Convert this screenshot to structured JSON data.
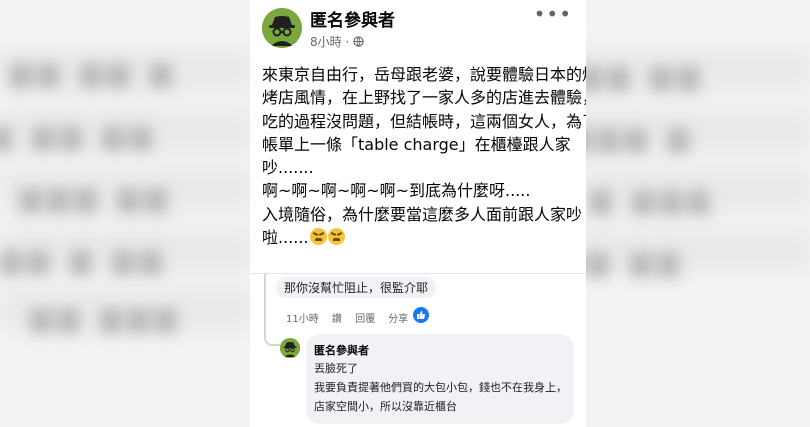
{
  "post": {
    "author": "匿名參與者",
    "time": "8小時",
    "more_label": "•••",
    "lines": [
      "來東京自由行，岳母跟老婆，說要體驗日本的燒",
      "烤店風情，在上野找了一家人多的店進去體驗，",
      "吃的過程沒問題，但結帳時，這兩個女人，為了",
      "帳單上一條「table charge」在櫃檯跟人家",
      "吵.......",
      "啊~啊~啊~啊~啊~到底為什麼呀.....",
      "入境隨俗，為什麼要當這麼多人面前跟人家吵",
      "啦......"
    ],
    "emoji": "tired-face"
  },
  "comment1": {
    "text": "那你沒幫忙阻止，很監介耶",
    "time": "11小時",
    "actions": [
      "讚",
      "回覆",
      "分享"
    ]
  },
  "comment2": {
    "author": "匿名參與者",
    "lines": [
      "丟臉死了",
      "我要負責提著他們買的大包小包，錢也不在我身上，",
      "店家空間小，所以沒靠近櫃台"
    ]
  },
  "colors": {
    "avatar": "#7ba83c",
    "like": "#1877f2"
  }
}
